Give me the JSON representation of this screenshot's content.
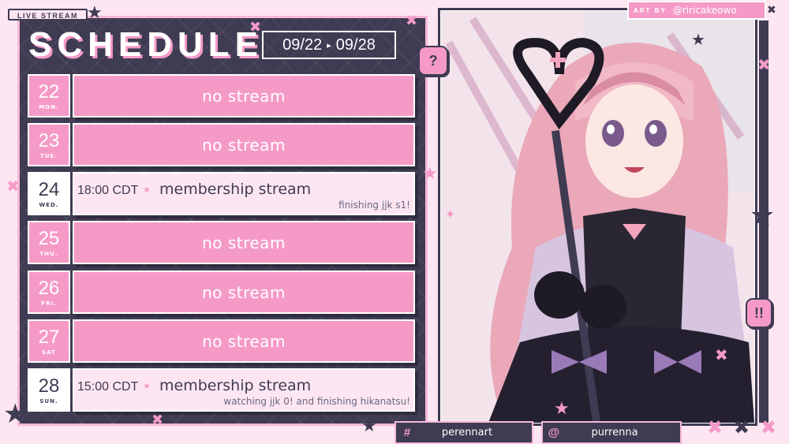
{
  "header": {
    "live_tag": "LIVE STREAM",
    "title": "SCHEDULE",
    "range_start": "09/22",
    "range_arrow": "▸",
    "range_end": "09/28"
  },
  "schedule": [
    {
      "day": "22",
      "dow": "MON.",
      "status": "no stream"
    },
    {
      "day": "23",
      "dow": "TUE.",
      "status": "no stream"
    },
    {
      "day": "24",
      "dow": "WED.",
      "time": "18:00 CDT",
      "status": "membership stream",
      "note": "finishing jjk s1!"
    },
    {
      "day": "25",
      "dow": "THU.",
      "status": "no stream"
    },
    {
      "day": "26",
      "dow": "FRI.",
      "status": "no stream"
    },
    {
      "day": "27",
      "dow": "SAT",
      "status": "no stream"
    },
    {
      "day": "28",
      "dow": "SUN.",
      "time": "15:00 CDT",
      "status": "membership stream",
      "note": "watching jjk 0! and finishing hikanatsu!"
    }
  ],
  "credit": {
    "label": "ART BY",
    "handle": "@riricakeowo"
  },
  "bubbles": {
    "question": "?",
    "exclaim": "!!"
  },
  "socials": [
    {
      "symbol": "#",
      "name": "perennart"
    },
    {
      "symbol": "@",
      "name": "purrenna"
    }
  ],
  "colors": {
    "dark": "#3e3b52",
    "pink": "#f59ac7",
    "light": "#fde6f2"
  },
  "icons": [
    "star-icon",
    "cross-icon",
    "sparkle-icon"
  ]
}
